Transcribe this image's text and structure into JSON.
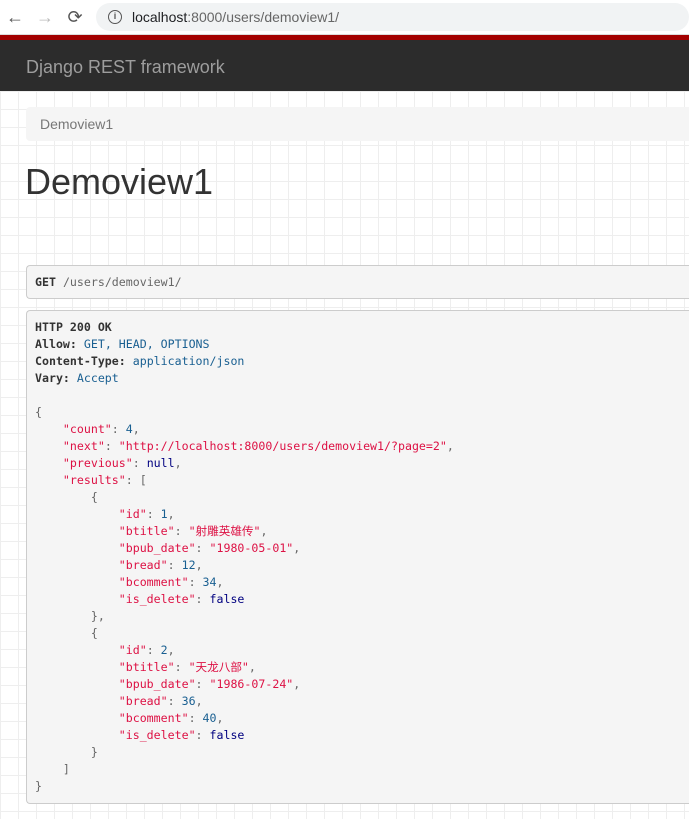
{
  "browser": {
    "url_host": "localhost",
    "url_path": ":8000/users/demoview1/"
  },
  "navbar": {
    "brand": "Django REST framework"
  },
  "breadcrumb": {
    "item": "Demoview1"
  },
  "page": {
    "title": "Demoview1"
  },
  "request": {
    "method": "GET",
    "path": "/users/demoview1/"
  },
  "response": {
    "status": "HTTP 200 OK",
    "headers": [
      {
        "name": "Allow:",
        "value": "GET, HEAD, OPTIONS"
      },
      {
        "name": "Content-Type:",
        "value": "application/json"
      },
      {
        "name": "Vary:",
        "value": "Accept"
      }
    ],
    "lines": [
      [
        [
          "p",
          "{"
        ]
      ],
      [
        [
          "w",
          "    "
        ],
        [
          "k",
          "\"count\""
        ],
        [
          "p",
          ": "
        ],
        [
          "n",
          "4"
        ],
        [
          "p",
          ","
        ]
      ],
      [
        [
          "w",
          "    "
        ],
        [
          "k",
          "\"next\""
        ],
        [
          "p",
          ": "
        ],
        [
          "s",
          "\"http://localhost:8000/users/demoview1/?page=2\""
        ],
        [
          "p",
          ","
        ]
      ],
      [
        [
          "w",
          "    "
        ],
        [
          "k",
          "\"previous\""
        ],
        [
          "p",
          ": "
        ],
        [
          "l",
          "null"
        ],
        [
          "p",
          ","
        ]
      ],
      [
        [
          "w",
          "    "
        ],
        [
          "k",
          "\"results\""
        ],
        [
          "p",
          ": ["
        ]
      ],
      [
        [
          "w",
          "        "
        ],
        [
          "p",
          "{"
        ]
      ],
      [
        [
          "w",
          "            "
        ],
        [
          "k",
          "\"id\""
        ],
        [
          "p",
          ": "
        ],
        [
          "n",
          "1"
        ],
        [
          "p",
          ","
        ]
      ],
      [
        [
          "w",
          "            "
        ],
        [
          "k",
          "\"btitle\""
        ],
        [
          "p",
          ": "
        ],
        [
          "s",
          "\"射雕英雄传\""
        ],
        [
          "p",
          ","
        ]
      ],
      [
        [
          "w",
          "            "
        ],
        [
          "k",
          "\"bpub_date\""
        ],
        [
          "p",
          ": "
        ],
        [
          "s",
          "\"1980-05-01\""
        ],
        [
          "p",
          ","
        ]
      ],
      [
        [
          "w",
          "            "
        ],
        [
          "k",
          "\"bread\""
        ],
        [
          "p",
          ": "
        ],
        [
          "n",
          "12"
        ],
        [
          "p",
          ","
        ]
      ],
      [
        [
          "w",
          "            "
        ],
        [
          "k",
          "\"bcomment\""
        ],
        [
          "p",
          ": "
        ],
        [
          "n",
          "34"
        ],
        [
          "p",
          ","
        ]
      ],
      [
        [
          "w",
          "            "
        ],
        [
          "k",
          "\"is_delete\""
        ],
        [
          "p",
          ": "
        ],
        [
          "l",
          "false"
        ]
      ],
      [
        [
          "w",
          "        "
        ],
        [
          "p",
          "},"
        ]
      ],
      [
        [
          "w",
          "        "
        ],
        [
          "p",
          "{"
        ]
      ],
      [
        [
          "w",
          "            "
        ],
        [
          "k",
          "\"id\""
        ],
        [
          "p",
          ": "
        ],
        [
          "n",
          "2"
        ],
        [
          "p",
          ","
        ]
      ],
      [
        [
          "w",
          "            "
        ],
        [
          "k",
          "\"btitle\""
        ],
        [
          "p",
          ": "
        ],
        [
          "s",
          "\"天龙八部\""
        ],
        [
          "p",
          ","
        ]
      ],
      [
        [
          "w",
          "            "
        ],
        [
          "k",
          "\"bpub_date\""
        ],
        [
          "p",
          ": "
        ],
        [
          "s",
          "\"1986-07-24\""
        ],
        [
          "p",
          ","
        ]
      ],
      [
        [
          "w",
          "            "
        ],
        [
          "k",
          "\"bread\""
        ],
        [
          "p",
          ": "
        ],
        [
          "n",
          "36"
        ],
        [
          "p",
          ","
        ]
      ],
      [
        [
          "w",
          "            "
        ],
        [
          "k",
          "\"bcomment\""
        ],
        [
          "p",
          ": "
        ],
        [
          "n",
          "40"
        ],
        [
          "p",
          ","
        ]
      ],
      [
        [
          "w",
          "            "
        ],
        [
          "k",
          "\"is_delete\""
        ],
        [
          "p",
          ": "
        ],
        [
          "l",
          "false"
        ]
      ],
      [
        [
          "w",
          "        "
        ],
        [
          "p",
          "}"
        ]
      ],
      [
        [
          "w",
          "    "
        ],
        [
          "p",
          "]"
        ]
      ],
      [
        [
          "p",
          "}"
        ]
      ]
    ]
  }
}
